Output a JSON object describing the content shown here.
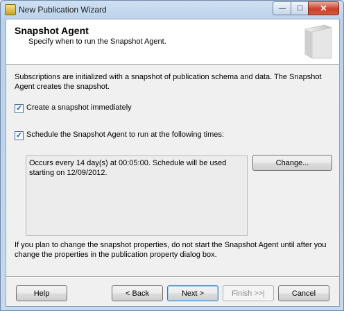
{
  "window": {
    "title": "New Publication Wizard",
    "minimize_glyph": "—",
    "maximize_glyph": "☐",
    "close_glyph": "✕"
  },
  "header": {
    "title": "Snapshot Agent",
    "subtitle": "Specify when to run the Snapshot Agent."
  },
  "intro_text": "Subscriptions are initialized with a snapshot of publication schema and data. The Snapshot Agent creates the snapshot.",
  "options": {
    "create_snapshot": {
      "label": "Create a snapshot immediately",
      "checked": true,
      "check_glyph": "✓"
    },
    "schedule_agent": {
      "label": "Schedule the Snapshot Agent to run at the following times:",
      "checked": true,
      "check_glyph": "✓"
    }
  },
  "schedule": {
    "description": "Occurs every 14 day(s) at 00:05:00. Schedule will be used starting on 12/09/2012.",
    "change_label": "Change..."
  },
  "note_text": "If you plan to change the snapshot properties, do not start the Snapshot Agent until after you change the properties in the publication property dialog box.",
  "footer": {
    "help_label": "Help",
    "back_label": "< Back",
    "next_label": "Next >",
    "finish_label": "Finish >>|",
    "cancel_label": "Cancel"
  }
}
